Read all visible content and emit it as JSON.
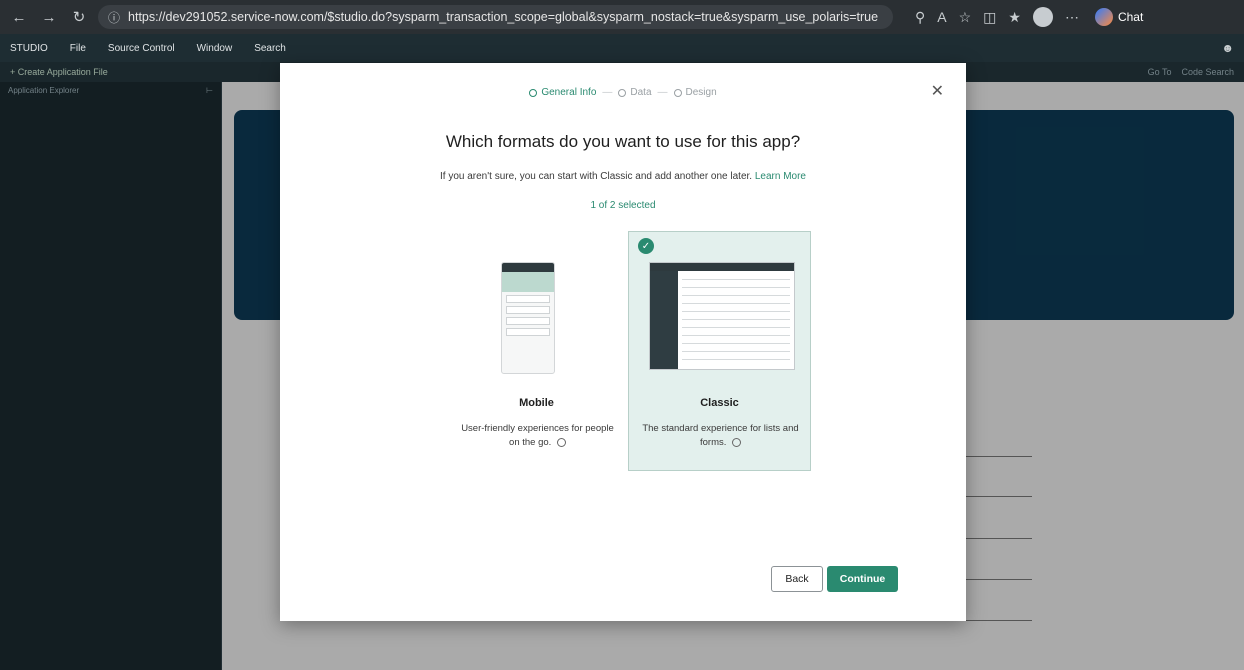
{
  "browser": {
    "url": "https://dev291052.service-now.com/$studio.do?sysparm_transaction_scope=global&sysparm_nostack=true&sysparm_use_polaris=true",
    "chat_label": "Chat"
  },
  "menubar": {
    "items": [
      "STUDIO",
      "File",
      "Source Control",
      "Window",
      "Search"
    ]
  },
  "toolbar": {
    "create_file_label": "+ Create Application File",
    "go_to_label": "Go To",
    "code_search_label": "Code Search"
  },
  "sidebar": {
    "header_label": "Application Explorer"
  },
  "modal": {
    "steps": [
      {
        "label": "General Info",
        "state": "active"
      },
      {
        "label": "Data",
        "state": "pending"
      },
      {
        "label": "Design",
        "state": "pending"
      }
    ],
    "title": "Which formats do you want to use for this app?",
    "subtitle": "If you aren't sure, you can start with Classic and add another one later.",
    "learn_more": "Learn More",
    "selected_count": "1 of 2 selected",
    "cards": [
      {
        "title": "Mobile",
        "description": "User-friendly experiences for people on the go.",
        "selected": false
      },
      {
        "title": "Classic",
        "description": "The standard experience for lists and forms.",
        "selected": true
      }
    ],
    "back_label": "Back",
    "continue_label": "Continue"
  },
  "colors": {
    "accent": "#2a8a70",
    "selected_card_bg": "#e3f0ed",
    "hero_bg": "#0d3a55"
  }
}
